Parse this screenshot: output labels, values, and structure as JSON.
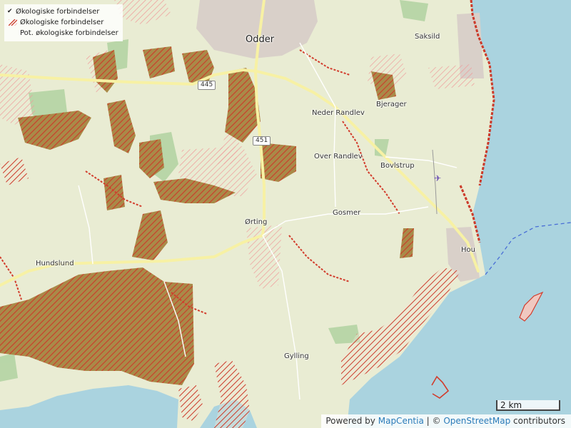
{
  "legend": {
    "items": [
      {
        "label": "Økologiske forbindelser",
        "checked": true
      },
      {
        "label": "Økologiske forbindelser",
        "swatch": "red-hatch"
      },
      {
        "label": "Pot. økologiske forbindelser",
        "swatch": "pink-hatch"
      }
    ]
  },
  "places": {
    "odder": "Odder",
    "saksild": "Saksild",
    "neder_randlev": "Neder Randlev",
    "bjerager": "Bjerager",
    "over_randlev": "Over Randlev",
    "bovlstrup": "Bovlstrup",
    "gosmer": "Gosmer",
    "orting": "Ørting",
    "hou": "Hou",
    "hundslund": "Hundslund",
    "gylling": "Gylling"
  },
  "roads": {
    "r445": "445",
    "r451": "451"
  },
  "scale": "2 km",
  "attribution": {
    "prefix": "Powered by",
    "mapcentia": "MapCentia",
    "separator": "| ©",
    "osm": "OpenStreetMap",
    "suffix": "contributors"
  },
  "colors": {
    "land": "#e9ecd3",
    "sea": "#aad3df",
    "eco_red": "#d23c2c",
    "pot_pink": "#f1a0a0",
    "forest": "#add19e",
    "brown": "#9a7a3a"
  }
}
